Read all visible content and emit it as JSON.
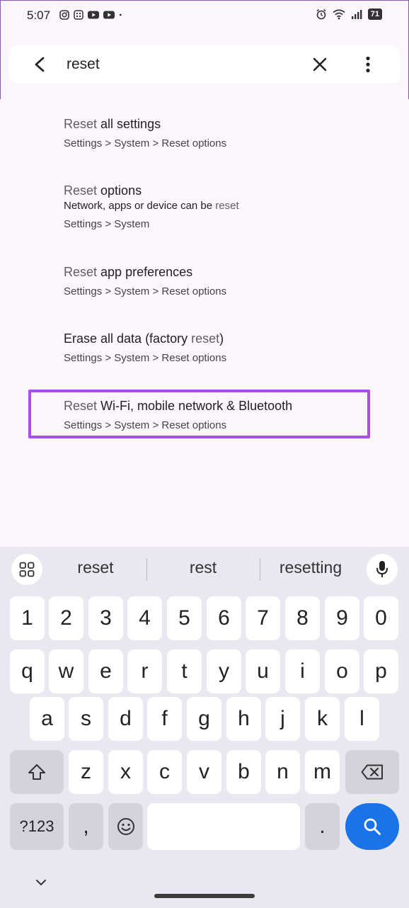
{
  "status_bar": {
    "time": "5:07",
    "battery": "71",
    "left_icons": [
      "instagram-icon",
      "grid-app-icon",
      "youtube-icon",
      "youtube-icon",
      "dot-icon"
    ],
    "right_icons": [
      "alarm-icon",
      "wifi-icon",
      "signal-icon",
      "battery-icon"
    ]
  },
  "search": {
    "query": "reset",
    "back_icon": "back-arrow-icon",
    "clear_icon": "close-icon",
    "more_icon": "more-vert-icon"
  },
  "results": [
    {
      "title_highlight": "Reset",
      "title_rest": " all settings",
      "summary_pre": "",
      "summary_highlight": "",
      "path": "Settings > System > Reset options"
    },
    {
      "title_highlight": "Reset",
      "title_rest": " options",
      "summary_pre": "Network, apps or device can be ",
      "summary_highlight": "reset",
      "path": "Settings > System"
    },
    {
      "title_highlight": "Reset",
      "title_rest": " app preferences",
      "summary_pre": "",
      "summary_highlight": "",
      "path": "Settings > System > Reset options"
    },
    {
      "title_pre": "Erase all data (factory ",
      "title_highlight": "reset",
      "title_post": ")",
      "summary_pre": "",
      "summary_highlight": "",
      "path": "Settings > System > Reset options"
    },
    {
      "title_highlight": "Reset",
      "title_rest": " Wi-Fi, mobile network & Bluetooth",
      "summary_pre": "",
      "summary_highlight": "",
      "path": "Settings > System > Reset options",
      "highlight_color": "#a94ef0"
    }
  ],
  "keyboard": {
    "suggestions": [
      "reset",
      "rest",
      "resetting"
    ],
    "number_row": [
      "1",
      "2",
      "3",
      "4",
      "5",
      "6",
      "7",
      "8",
      "9",
      "0"
    ],
    "row1": [
      "q",
      "w",
      "e",
      "r",
      "t",
      "y",
      "u",
      "i",
      "o",
      "p"
    ],
    "row2": [
      "a",
      "s",
      "d",
      "f",
      "g",
      "h",
      "j",
      "k",
      "l"
    ],
    "row3": [
      "z",
      "x",
      "c",
      "v",
      "b",
      "n",
      "m"
    ],
    "symbols_label": "?123",
    "comma": ",",
    "period": ".",
    "accent_color": "#1a73e8"
  }
}
